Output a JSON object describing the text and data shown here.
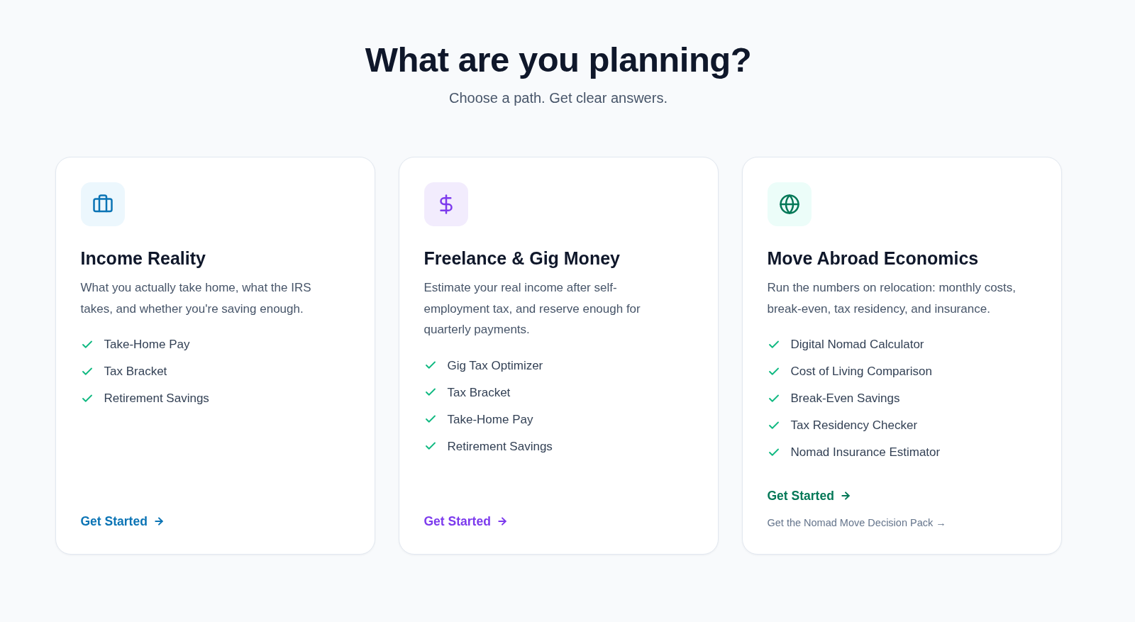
{
  "header": {
    "title": "What are you planning?",
    "subtitle": "Choose a path. Get clear answers."
  },
  "cards": [
    {
      "title": "Income Reality",
      "description": "What you actually take home, what the IRS takes, and whether you're saving enough.",
      "color": "#0b74b5",
      "features": [
        "Take-Home Pay",
        "Tax Bracket",
        "Retirement Savings"
      ],
      "cta": "Get Started"
    },
    {
      "title": "Freelance & Gig Money",
      "description": "Estimate your real income after self-employment tax, and reserve enough for quarterly payments.",
      "color": "#7c3aed",
      "features": [
        "Gig Tax Optimizer",
        "Tax Bracket",
        "Take-Home Pay",
        "Retirement Savings"
      ],
      "cta": "Get Started"
    },
    {
      "title": "Move Abroad Economics",
      "description": "Run the numbers on relocation: monthly costs, break-even, tax residency, and insurance.",
      "color": "#047857",
      "features": [
        "Digital Nomad Calculator",
        "Cost of Living Comparison",
        "Break-Even Savings",
        "Tax Residency Checker",
        "Nomad Insurance Estimator"
      ],
      "cta": "Get Started",
      "extra_link": "Get the Nomad Move Decision Pack →"
    }
  ]
}
